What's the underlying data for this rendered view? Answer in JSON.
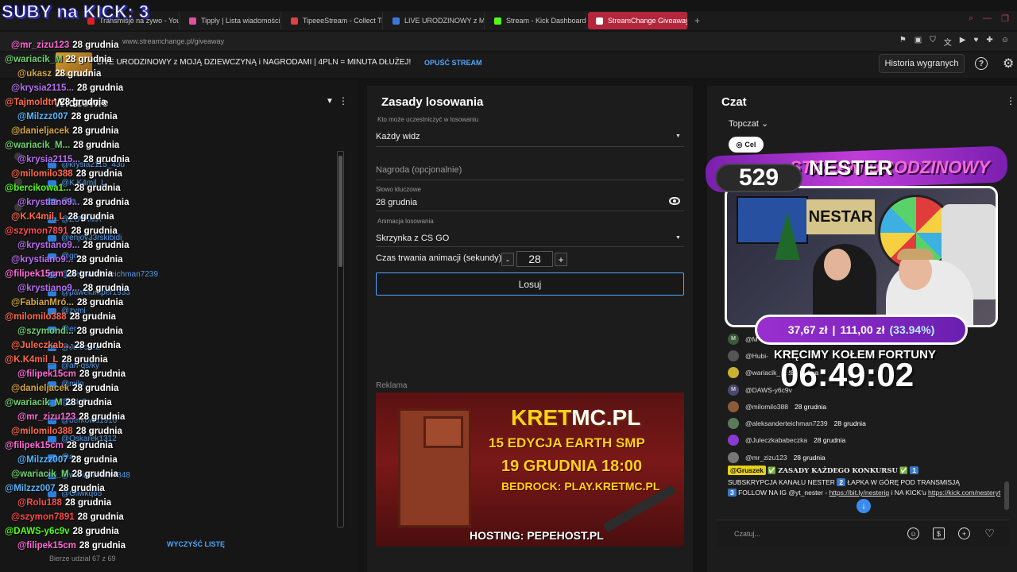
{
  "browser": {
    "tabs": [
      {
        "label": "Transmisje na żywo - You",
        "color": "#e02020"
      },
      {
        "label": "Tipply | Lista wiadomości",
        "color": "#e04fa0"
      },
      {
        "label": "TipeeeStream - Collect Ti",
        "color": "#e04040"
      },
      {
        "label": "LIVE URODZINOWY z MO",
        "color": "#3a78e0"
      },
      {
        "label": "Stream - Kick Dashboard",
        "color": "#53fc18"
      },
      {
        "label": "StreamChange Giveaway",
        "color": "#ffffff"
      }
    ],
    "url": "www.streamchange.pl/giveaway"
  },
  "header": {
    "stream_title": "LIVE URODZINOWY z MOJĄ DZIEWCZYNĄ i NAGRODAMI | 4PLN = MINUTA DŁUŻEJ!",
    "leave_link": "OPUŚĆ STREAM",
    "history_button": "Historia wygranych",
    "help_label": "?"
  },
  "viewers_panel": {
    "title": "Widzowie",
    "items": [
      "@krysia2115_43u",
      "@K.K4mil_L",
      "@fa",
      "@ZUWIMA",
      "@enjoy33rskibidi",
      "@gn",
      "@aleksanderteichman7239",
      "@pawelumper1933",
      "@zymi",
      "@er",
      "@Juleczka",
      "@an-qs/ky",
      "@milo",
      "@adelle",
      "@berkowa1916",
      "@Oskarek1312",
      "@a",
      "@wariacikkula4848",
      "@Oliwkq65"
    ],
    "clear_link": "WYCZYŚĆ LISTĘ",
    "count_text": "Bierze udział 67 z 69"
  },
  "overlay": {
    "title": "SUBY na KICK: 3",
    "message": "28 grudnia",
    "rows": [
      {
        "name": "@mr_zizu123",
        "color": "#ff6ad5"
      },
      {
        "name": "@wariacik_M",
        "color": "#6fd16f"
      },
      {
        "name": "@ukasz",
        "color": "#d6a640"
      },
      {
        "name": "@krysia2115...",
        "color": "#b76ff0"
      },
      {
        "name": "@Tajmoldtn",
        "color": "#ff6a4a"
      },
      {
        "name": "@Milzzz007",
        "color": "#55b7ff"
      },
      {
        "name": "@danieljacek",
        "color": "#d6a640"
      },
      {
        "name": "@wariacik_M...",
        "color": "#6fd16f"
      },
      {
        "name": "@krysia2115...",
        "color": "#b76ff0"
      },
      {
        "name": "@milomilo388",
        "color": "#ff6a4a"
      },
      {
        "name": "@bercikowa1...",
        "color": "#53fc18"
      },
      {
        "name": "@krystiano9...",
        "color": "#b76ff0"
      },
      {
        "name": "@K.K4mil_L",
        "color": "#ff6a4a"
      },
      {
        "name": "@szymon7891",
        "color": "#ff4a4a"
      },
      {
        "name": "@krystiano9...",
        "color": "#b76ff0"
      },
      {
        "name": "@krystiano9...",
        "color": "#b76ff0"
      },
      {
        "name": "@filipek15cm",
        "color": "#ff6ad5"
      },
      {
        "name": "@krystiano9...",
        "color": "#b76ff0"
      },
      {
        "name": "@FabianMró...",
        "color": "#d6a640"
      },
      {
        "name": "@milomilo388",
        "color": "#ff6a4a"
      },
      {
        "name": "@szymond...",
        "color": "#6fd16f"
      },
      {
        "name": "@Juleczkab...",
        "color": "#ff6a4a"
      },
      {
        "name": "@K.K4mil_L",
        "color": "#ff6a4a"
      },
      {
        "name": "@filipek15cm",
        "color": "#ff6ad5"
      },
      {
        "name": "@danieljacek",
        "color": "#d6a640"
      },
      {
        "name": "@wariacik_M",
        "color": "#6fd16f"
      },
      {
        "name": "@mr_zizu123",
        "color": "#ff6ad5"
      },
      {
        "name": "@milomilo388",
        "color": "#ff6a4a"
      },
      {
        "name": "@filipek15cm",
        "color": "#ff6ad5"
      },
      {
        "name": "@Milzzz007",
        "color": "#55b7ff"
      },
      {
        "name": "@wariacik_M",
        "color": "#6fd16f"
      },
      {
        "name": "@Milzzz007",
        "color": "#55b7ff"
      },
      {
        "name": "@Rolu188",
        "color": "#ff4a4a"
      },
      {
        "name": "@szymon7891",
        "color": "#ff4a4a"
      },
      {
        "name": "@DAWS-y6c9v",
        "color": "#53fc18"
      },
      {
        "name": "@filipek15cm",
        "color": "#ff6ad5"
      }
    ]
  },
  "rules_panel": {
    "title": "Zasady losowania",
    "who_label": "Kto może uczestniczyć w losowaniu",
    "who_value": "Każdy widz",
    "prize_placeholder": "Nagroda (opcjonalnie)",
    "keyword_label": "Słowo kluczowe",
    "keyword_value": "28 grudnia",
    "animation_label": "Animacja losowania",
    "animation_value": "Skrzynka z CS GO",
    "duration_label": "Czas trwania animacji (sekundy)",
    "duration_value": "28",
    "minus": "-",
    "plus": "+",
    "draw_button": "Losuj",
    "ad_label": "Reklama",
    "ad": {
      "line1_a": "KRET",
      "line1_b": "MC.PL",
      "line2": "15 EDYCJA EARTH SMP",
      "line3": "19 GRUDNIA 18:00",
      "line4": "BEDROCK: PLAY.KRETMC.PL",
      "line5": "HOSTING: PEPEHOST.PL"
    }
  },
  "chat_panel": {
    "title": "Czat",
    "top_chat": "Topczat",
    "goal": "Cel",
    "overlay": {
      "banner": "STREAM URODZINOWY",
      "subs": "529",
      "name": "NESTER",
      "sign": "NESTAR",
      "money_current": "37,67 zł",
      "money_goal": "111,00 zł",
      "money_pct": "(33.94%)",
      "wheel_title": "KRĘCIMY KOŁEM FORTUNY",
      "timer": "06:49:02"
    },
    "messages": [
      {
        "avatar": "M",
        "user": "@M",
        "text": "",
        "color": "#3a5a3a"
      },
      {
        "avatar": "",
        "user": "@Hubi-",
        "text": "",
        "color": "#555"
      },
      {
        "avatar": "",
        "user": "@wariacik_",
        "text": "28 grudnia",
        "color": "#c9b030"
      },
      {
        "avatar": "M",
        "user": "@DAWS-y6c9v",
        "text": "",
        "color": "#4a4a70"
      },
      {
        "avatar": "",
        "user": "@milomilo388",
        "text": "28 grudnia",
        "color": "#8a5a3a"
      },
      {
        "avatar": "",
        "user": "@aleksanderteichman7239",
        "text": "28 grudnia",
        "color": "#5a7a5a"
      },
      {
        "avatar": "",
        "user": "@Juleczkababeczka",
        "text": "28 grudnia",
        "color": "#8a3ad0"
      },
      {
        "avatar": "",
        "user": "@mr_zizu123",
        "text": "28 grudnia",
        "color": "#777"
      }
    ],
    "pinned": {
      "user": "@Gruszek",
      "heading": "ZASADY KAŻDEGO KONKURSU",
      "n1": "1",
      "t1": "SUBSKRYPCJA KANAŁU NESTER",
      "n2": "2",
      "t2": "ŁAPKA W GÓRĘ POD TRANSMISJĄ",
      "n3": "3",
      "t3": "FOLLOW NA IG @yt_nester -",
      "link1": "https://bit.ly/nesterig",
      "t4": "i NA KICK'u",
      "link2": "https://kick.com/nesteryt"
    },
    "input_placeholder": "Czatuj..."
  }
}
